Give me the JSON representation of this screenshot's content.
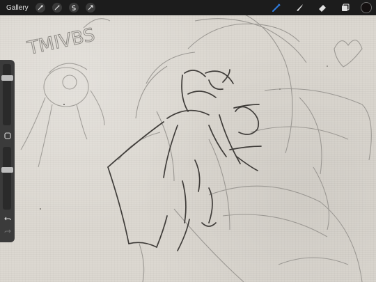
{
  "app": {
    "gallery_label": "Gallery",
    "toolbar_left_icons": [
      "wrench-icon",
      "magic-wand-icon",
      "selection-s-icon",
      "transform-arrow-icon"
    ],
    "toolbar_right_icons": [
      "brush-icon",
      "smudge-icon",
      "eraser-icon",
      "layers-icon"
    ],
    "current_color": "#141010",
    "active_tool_color": "#2f7de1"
  },
  "sidebar": {
    "brush_size_level": 0.2,
    "opacity_level": 0.35,
    "icons": [
      "modify-square-icon",
      "undo-icon",
      "redo-icon"
    ]
  },
  "canvas": {
    "background_color": "#dcd8d1",
    "sketch_text": "TMIVBS"
  }
}
